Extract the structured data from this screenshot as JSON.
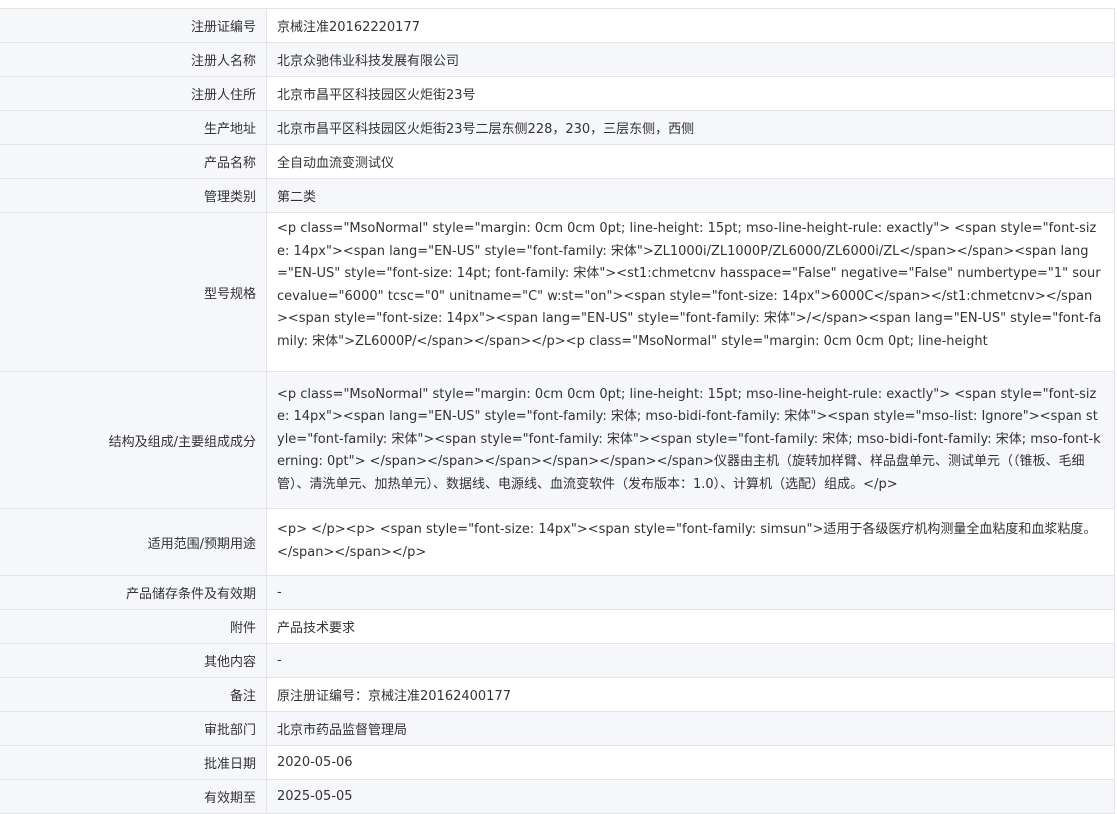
{
  "rows": [
    {
      "label": "注册证编号",
      "value": "京械注准20162220177"
    },
    {
      "label": "注册人名称",
      "value": "北京众驰伟业科技发展有限公司"
    },
    {
      "label": "注册人住所",
      "value": "北京市昌平区科技园区火炬街23号"
    },
    {
      "label": "生产地址",
      "value": "北京市昌平区科技园区火炬街23号二层东侧228，230，三层东侧，西侧"
    },
    {
      "label": "产品名称",
      "value": "全自动血流变测试仪"
    },
    {
      "label": "管理类别",
      "value": "第二类"
    },
    {
      "label": "型号规格",
      "value": "<p class=\"MsoNormal\" style=\"margin: 0cm 0cm 0pt; line-height: 15pt; mso-line-height-rule: exactly\"> <span style=\"font-size: 14px\"><span lang=\"EN-US\" style=\"font-family: 宋体\">ZL1000i/ZL1000P/ZL6000/ZL6000i/ZL</span></span><span lang=\"EN-US\" style=\"font-size: 14pt; font-family: 宋体\"><st1:chmetcnv hasspace=\"False\" negative=\"False\" numbertype=\"1\" sourcevalue=\"6000\" tcsc=\"0\" unitname=\"C\" w:st=\"on\"><span style=\"font-size: 14px\">6000C</span></st1:chmetcnv></span><span style=\"font-size: 14px\"><span lang=\"EN-US\" style=\"font-family: 宋体\">/</span><span lang=\"EN-US\" style=\"font-family: 宋体\">ZL6000P/</span></span></p><p class=\"MsoNormal\" style=\"margin: 0cm 0cm 0pt; line-height"
    },
    {
      "label": "结构及组成/主要组成成分",
      "value": "<p class=\"MsoNormal\" style=\"margin: 0cm 0cm 0pt; line-height: 15pt; mso-line-height-rule: exactly\"> <span style=\"font-size: 14px\"><span lang=\"EN-US\" style=\"font-family: 宋体; mso-bidi-font-family: 宋体\"><span style=\"mso-list: Ignore\"><span style=\"font-family: 宋体\"><span style=\"font-family: 宋体\"><span style=\"font-family: 宋体; mso-bidi-font-family: 宋体; mso-font-kerning: 0pt\"> </span></span></span></span></span></span>仪器由主机（旋转加样臂、样品盘单元、测试单元（（锥板、毛细管）、清洗单元、加热单元）、数据线、电源线、血流变软件（发布版本：1.0）、计算机（选配）组成。</p>"
    },
    {
      "label": "适用范围/预期用途",
      "value": "<p> </p><p> <span style=\"font-size: 14px\"><span style=\"font-family: simsun\">适用于各级医疗机构测量全血粘度和血浆粘度。</span></span></p>"
    },
    {
      "label": "产品储存条件及有效期",
      "value": "-"
    },
    {
      "label": "附件",
      "value": "产品技术要求"
    },
    {
      "label": "其他内容",
      "value": "-"
    },
    {
      "label": "备注",
      "value": "原注册证编号：京械注准20162400177"
    },
    {
      "label": "审批部门",
      "value": "北京市药品监督管理局"
    },
    {
      "label": "批准日期",
      "value": "2020-05-06"
    },
    {
      "label": "有效期至",
      "value": "2025-05-05"
    }
  ]
}
